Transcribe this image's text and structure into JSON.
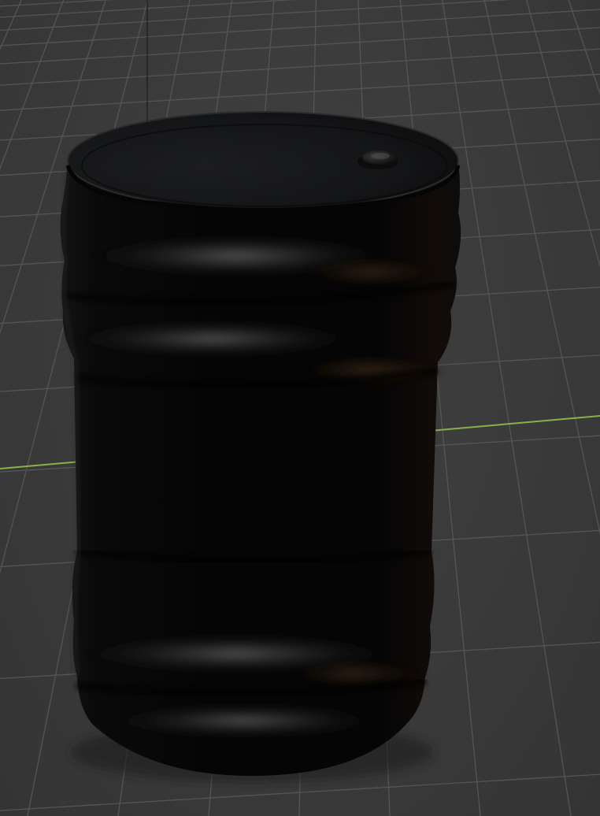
{
  "viewport": {
    "view": "perspective",
    "background_color": "#3a3a3a",
    "grid_color": "#555555",
    "x_axis_color": "#8ab04a",
    "z_axis_color": "#1f1f1f"
  },
  "scene": {
    "object": "barrel",
    "object_color": "#050505",
    "highlight_color": "#8a8a8a",
    "rim_light_color": "#6b4a2a"
  }
}
